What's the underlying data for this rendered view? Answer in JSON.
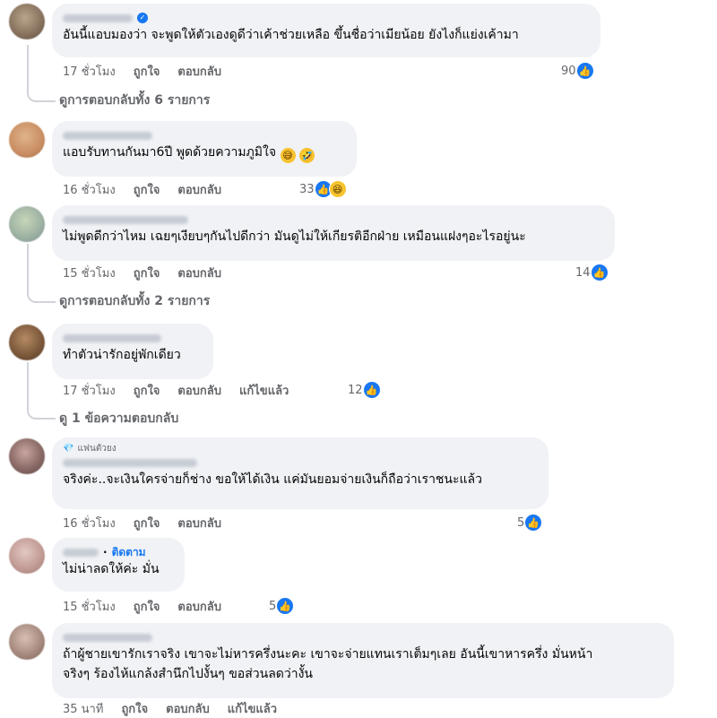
{
  "comments": [
    {
      "text": "อันนี้แอบมองว่า จะพูดให้ตัวเองดูดีว่าเค้าช่วยเหลือ ขึ้นชื่อว่าเมียน้อย ยังไงก็แย่งเค้ามา",
      "time": "17 ชั่วโมง",
      "like": "ถูกใจ",
      "reply": "ตอบกลับ",
      "reactions": "90",
      "replies_label": "ดูการตอบกลับทั้ง 6 รายการ"
    },
    {
      "text": "แอบรับทานกันมา6ปี พูดด้วยความภูมิใจ",
      "emoji1": "😅",
      "emoji2": "🤣",
      "time": "16 ชั่วโมง",
      "like": "ถูกใจ",
      "reply": "ตอบกลับ",
      "reactions": "33"
    },
    {
      "text": "ไม่พูดดีกว่าไหม เฉยๆเงียบๆกันไปดีกว่า มันดูไม่ให้เกียรติอีกฝ่าย เหมือนแฝงๆอะไรอยู่นะ",
      "time": "15 ชั่วโมง",
      "like": "ถูกใจ",
      "reply": "ตอบกลับ",
      "reactions": "14",
      "replies_label": "ดูการตอบกลับทั้ง 2 รายการ"
    },
    {
      "text": "ทำตัวน่ารักอยู่พักเดียว",
      "time": "17 ชั่วโมง",
      "like": "ถูกใจ",
      "reply": "ตอบกลับ",
      "edited": "แก้ไขแล้ว",
      "reactions": "12",
      "replies_label": "ดู 1 ข้อความตอบกลับ"
    },
    {
      "badge": "แฟนตัวยง",
      "text": "จริงค่ะ..จะเงินใครจ่ายก็ช่าง ขอให้ได้เงิน แค่มันยอมจ่ายเงินก็ถือว่าเราชนะแล้ว",
      "time": "16 ชั่วโมง",
      "like": "ถูกใจ",
      "reply": "ตอบกลับ",
      "reactions": "5"
    },
    {
      "follow": "ติดตาม",
      "text": "ไม่น่าลดให้ค่ะ มั่น",
      "time": "15 ชั่วโมง",
      "like": "ถูกใจ",
      "reply": "ตอบกลับ",
      "reactions": "5"
    },
    {
      "text_line1": "ถ้าผู้ชายเขารักเราจริง เขาจะไม่หารครึ่งนะคะ เขาจะจ่ายแทนเราเต็มๆเลย อันนี้เขาหารครึ่ง มั่นหน้า",
      "text_line2": "จริงๆ ร้องไห้แกล้งสำนึกไปงั้นๆ ขอส่วนลดว่างั้น",
      "time": "35 นาที",
      "like": "ถูกใจ",
      "reply": "ตอบกลับ",
      "edited": "แก้ไขแล้ว"
    }
  ],
  "colors": {
    "like_blue": "#1877f2",
    "bubble": "#f0f2f5",
    "meta": "#65676b"
  },
  "icons": {
    "like": "like-icon",
    "haha": "haha-icon",
    "verified": "verified-icon",
    "diamond": "diamond-icon"
  }
}
